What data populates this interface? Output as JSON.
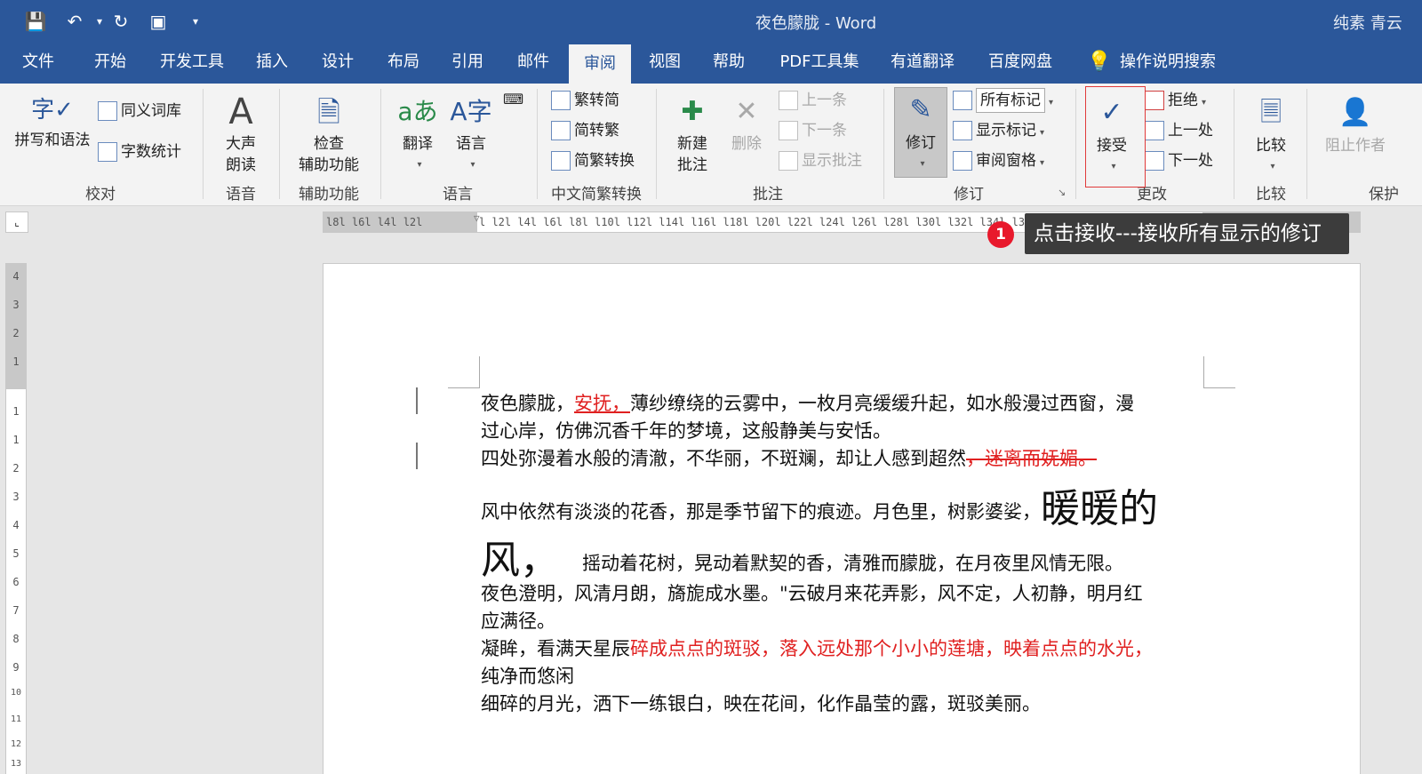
{
  "titlebar": {
    "doc_title": "夜色朦胧 - Word",
    "user": "纯素 青云"
  },
  "tabs": [
    {
      "label": "文件"
    },
    {
      "label": "开始"
    },
    {
      "label": "开发工具"
    },
    {
      "label": "插入"
    },
    {
      "label": "设计"
    },
    {
      "label": "布局"
    },
    {
      "label": "引用"
    },
    {
      "label": "邮件"
    },
    {
      "label": "审阅"
    },
    {
      "label": "视图"
    },
    {
      "label": "帮助"
    },
    {
      "label": "PDF工具集"
    },
    {
      "label": "有道翻译"
    },
    {
      "label": "百度网盘"
    },
    {
      "label": "操作说明搜索"
    }
  ],
  "ribbon": {
    "proofing": {
      "spell": "拼写和语法",
      "thesaurus": "同义词库",
      "wordcount": "字数统计",
      "group": "校对"
    },
    "speech": {
      "read1": "大声",
      "read2": "朗读",
      "group": "语音"
    },
    "access": {
      "check1": "检查",
      "check2": "辅助功能",
      "group": "辅助功能"
    },
    "language": {
      "translate": "翻译",
      "language": "语言",
      "group": "语言"
    },
    "chinese": {
      "t2s": "繁转简",
      "s2t": "简转繁",
      "convert": "简繁转换",
      "group": "中文简繁转换"
    },
    "comments": {
      "new1": "新建",
      "new2": "批注",
      "delete": "删除",
      "prev": "上一条",
      "next": "下一条",
      "show": "显示批注",
      "group": "批注"
    },
    "tracking": {
      "track": "修订",
      "markup": "所有标记",
      "showmarkup": "显示标记",
      "pane": "审阅窗格",
      "group": "修订"
    },
    "changes": {
      "accept": "接受",
      "reject": "拒绝",
      "prev": "上一处",
      "next": "下一处",
      "group": "更改"
    },
    "compare": {
      "compare": "比较",
      "group": "比较"
    },
    "protect": {
      "block": "阻止作者",
      "group": "保护"
    }
  },
  "ruler": {
    "left": "l8l l6l l4l l2l",
    "right": "l  l2l  l4l  l6l  l8l  l10l  l12l  l14l  l16l  l18l  l20l  l22l  l24l  l26l  l28l  l30l  l32l  l34l  l36l  l38l  l40l  l42l  l44l  l46l  l48"
  },
  "vruler": [
    "4",
    "3",
    "2",
    "1",
    "1",
    "1",
    "2",
    "3",
    "4",
    "5",
    "6",
    "7",
    "8",
    "9",
    "10",
    "11",
    "12",
    "13"
  ],
  "tooltip": {
    "badge": "1",
    "text": "点击接收---接收所有显示的修订"
  },
  "doc": {
    "l1a": "夜色朦胧，",
    "l1ins": "安抚，",
    "l1b": "薄纱缭绕的云雾中，一枚月亮缓缓升起，如水般漫过西窗，漫",
    "l2": "过心岸，仿佛沉香千年的梦境，这般静美与安恬。",
    "l3a": "四处弥漫着水般的清澈，不华丽，不斑斓，却让人感到超然",
    "l3del": "，迷离而妩媚。",
    "l4a": "风中依然有淡淡的花香，那是季节留下的痕迹。月色里，树影婆娑，",
    "l4big": "暖暖的",
    "l5big": "风，",
    "l5b": "摇动着花树，晃动着默契的香，清雅而朦胧，在月夜里风情无限。",
    "l6": "夜色澄明，风清月朗，旖旎成水墨。\"云破月来花弄影，风不定，人初静，明月红",
    "l7": "应满径。",
    "l8a": "凝眸，看满天星辰",
    "l8red": "碎成点点的斑驳，落入远处那个小小的莲塘，映着点点的水光，",
    "l9": "纯净而悠闲",
    "l10": "细碎的月光，洒下一练银白，映在花间，化作晶莹的露，斑驳美丽。"
  },
  "colors": {
    "accent": "#2b579a",
    "revision": "#e02020"
  }
}
